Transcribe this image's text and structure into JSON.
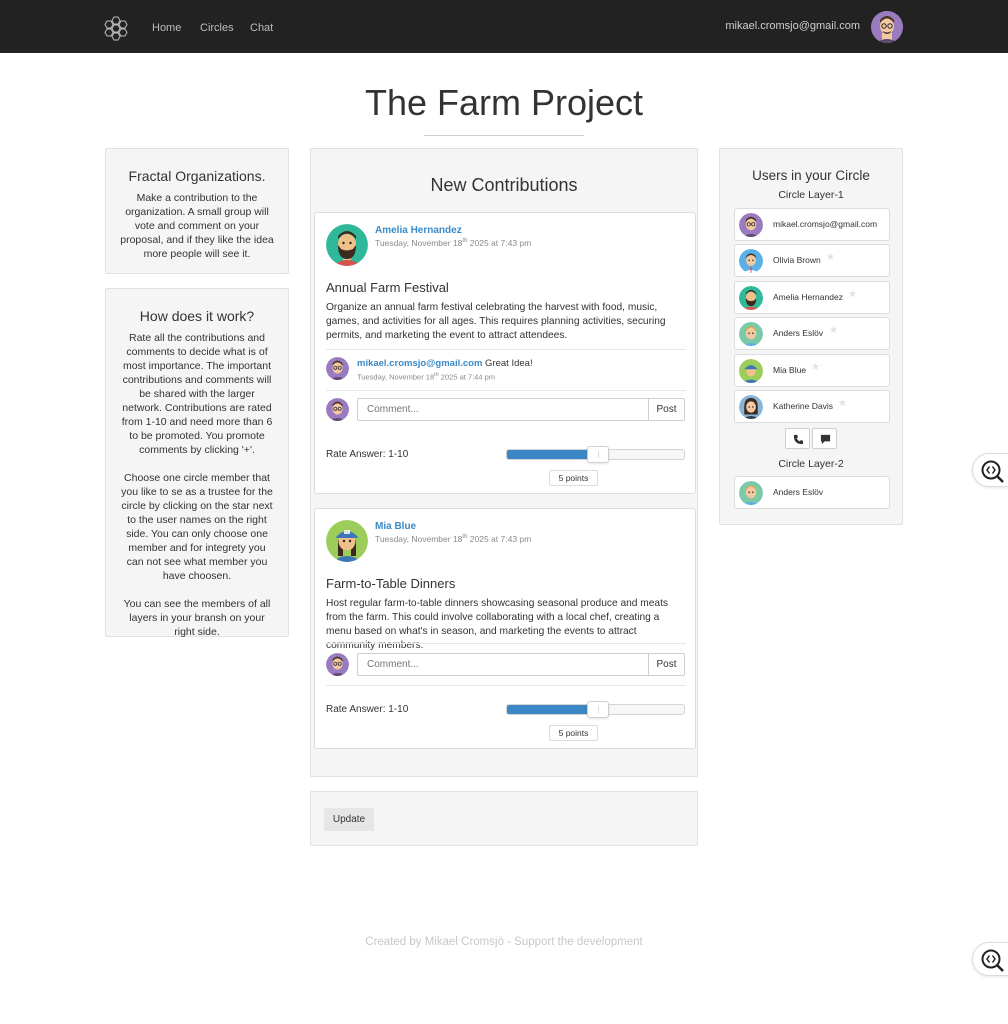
{
  "nav": {
    "links": [
      "Home",
      "Circles",
      "Chat"
    ],
    "user_email": "mikael.cromsjo@gmail.com",
    "logo_icon": "hexagon-cluster-logo",
    "avatar_icon": "user-avatar"
  },
  "page": {
    "title": "The Farm Project"
  },
  "left": {
    "about": {
      "heading": "Fractal Organizations.",
      "text": "Make a contribution to the organization. A small group will vote and comment on your proposal, and if they like the idea more people will see it."
    },
    "how": {
      "heading": "How does it work?",
      "text1": "Rate all the contributions and comments to decide what is of most importance. The important contributions and comments will be shared with the larger network. Contributions are rated from 1-10 and need more than 6 to be promoted. You promote comments by clicking '+'.",
      "text2": "Choose one circle member that you like to se as a trustee for the circle by clicking on the star next to the user names on the right side. You can only choose one member and for integrety you can not see what member you have choosen.",
      "text3": "You can see the members of all layers in your bransh on your right side."
    }
  },
  "center": {
    "heading": "New Contributions",
    "contributions": [
      {
        "author": "Amelia Hernandez",
        "time_pre": "Tuesday, November 18",
        "time_sup": "th",
        "time_post": " 2025 at 7:43 pm",
        "title": "Annual Farm Festival",
        "text": "Organize an annual farm festival celebrating the harvest with food, music, games, and activities for all ages. This requires planning activities, securing permits, and marketing the event to attract attendees.",
        "comment": {
          "author": "mikael.cromsjo@gmail.com",
          "text": " Great Idea!",
          "time_pre": "Tuesday, November 18",
          "time_sup": "th",
          "time_post": " 2025 at 7:44 pm"
        },
        "comment_placeholder": "Comment...",
        "post_label": "Post",
        "rate_label": "Rate Answer: 1-10",
        "rating": 5,
        "points_label": "5 points"
      },
      {
        "author": "Mia Blue",
        "time_pre": "Tuesday, November 18",
        "time_sup": "th",
        "time_post": " 2025 at 7:43 pm",
        "title": "Farm-to-Table Dinners",
        "text": "Host regular farm-to-table dinners showcasing seasonal produce and meats from the farm. This could involve collaborating with a local chef, creating a menu based on what's in season, and marketing the events to attract community members.",
        "comment_placeholder": "Comment...",
        "post_label": "Post",
        "rate_label": "Rate Answer: 1-10",
        "rating": 5,
        "points_label": "5 points"
      }
    ],
    "update_label": "Update"
  },
  "right": {
    "heading": "Users in your Circle",
    "layer1": "Circle Layer-1",
    "layer2": "Circle Layer-2",
    "layer1_users": [
      {
        "name": "mikael.cromsjo@gmail.com",
        "star": false
      },
      {
        "name": "Olivia Brown",
        "star": true
      },
      {
        "name": "Amelia Hernandez",
        "star": true
      },
      {
        "name": "Anders Eslöv",
        "star": true
      },
      {
        "name": "Mia Blue",
        "star": true
      },
      {
        "name": "Katherine Davis",
        "star": true
      }
    ],
    "layer2_users": [
      {
        "name": "Anders Eslöv"
      }
    ],
    "star_glyph": "★",
    "phone_icon": "phone-icon",
    "chat_icon": "chat-bubble-icon"
  },
  "footer": {
    "text": "Created by Mikael Cromsjö - Support the development"
  },
  "colors": {
    "navbar": "#222222",
    "link": "#3a8ac8",
    "slider": "#3c86c6",
    "panel": "#f5f5f5"
  }
}
